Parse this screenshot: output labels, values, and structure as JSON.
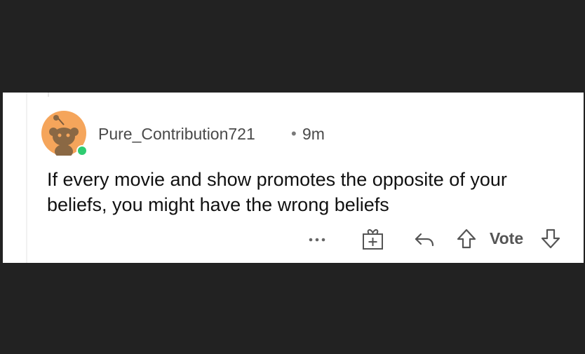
{
  "comment": {
    "username": "Pure_Contribution721",
    "separator": "•",
    "time_ago": "9m",
    "text": "If every movie and show promotes the opposite of your beliefs, you might have the wrong beliefs",
    "online": true
  },
  "actions": {
    "more_icon": "more-horizontal-icon",
    "award_icon": "gift-icon",
    "reply_icon": "reply-icon",
    "upvote_icon": "upvote-arrow-icon",
    "vote_label": "Vote",
    "downvote_icon": "downvote-arrow-icon"
  },
  "colors": {
    "background": "#222222",
    "card": "#ffffff",
    "avatar_bg": "#f5a55b",
    "online_dot": "#2ecc71",
    "text": "#111111",
    "meta_text": "#4a4a4a"
  }
}
